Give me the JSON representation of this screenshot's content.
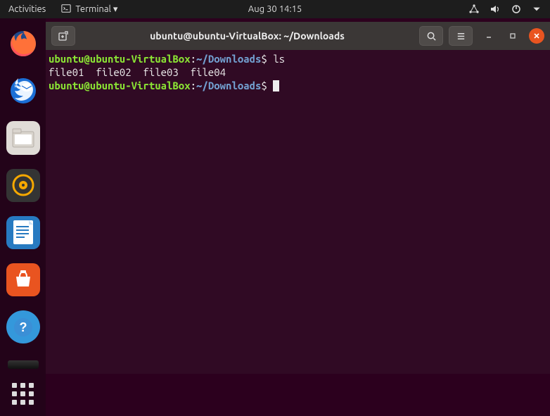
{
  "topbar": {
    "activities": "Activities",
    "app_indicator": "Terminal ▾",
    "datetime": "Aug 30  14:15"
  },
  "dock": {
    "items": [
      {
        "name": "firefox",
        "bg": "#2b2b2b",
        "glyph": "firefox"
      },
      {
        "name": "thunderbird",
        "bg": "#2b2b2b",
        "glyph": "thunderbird"
      },
      {
        "name": "files",
        "bg": "#a8a8a8",
        "glyph": "files"
      },
      {
        "name": "rhythmbox",
        "bg": "#2b2b2b",
        "glyph": "rhythmbox"
      },
      {
        "name": "libreoffice-writer",
        "bg": "#2b6bb5",
        "glyph": "writer"
      },
      {
        "name": "ubuntu-software",
        "bg": "#e95420",
        "glyph": "software"
      },
      {
        "name": "help",
        "bg": "#2b7fd5",
        "glyph": "help"
      }
    ]
  },
  "terminal": {
    "title": "ubuntu@ubuntu-VirtualBox: ~/Downloads",
    "lines": [
      {
        "user": "ubuntu@ubuntu-VirtualBox",
        "sep": ":",
        "path": "~/Downloads",
        "dollar": "$ ",
        "cmd": "ls"
      },
      {
        "plain": "file01  file02  file03  file04"
      },
      {
        "user": "ubuntu@ubuntu-VirtualBox",
        "sep": ":",
        "path": "~/Downloads",
        "dollar": "$ ",
        "cursor": true
      }
    ]
  }
}
